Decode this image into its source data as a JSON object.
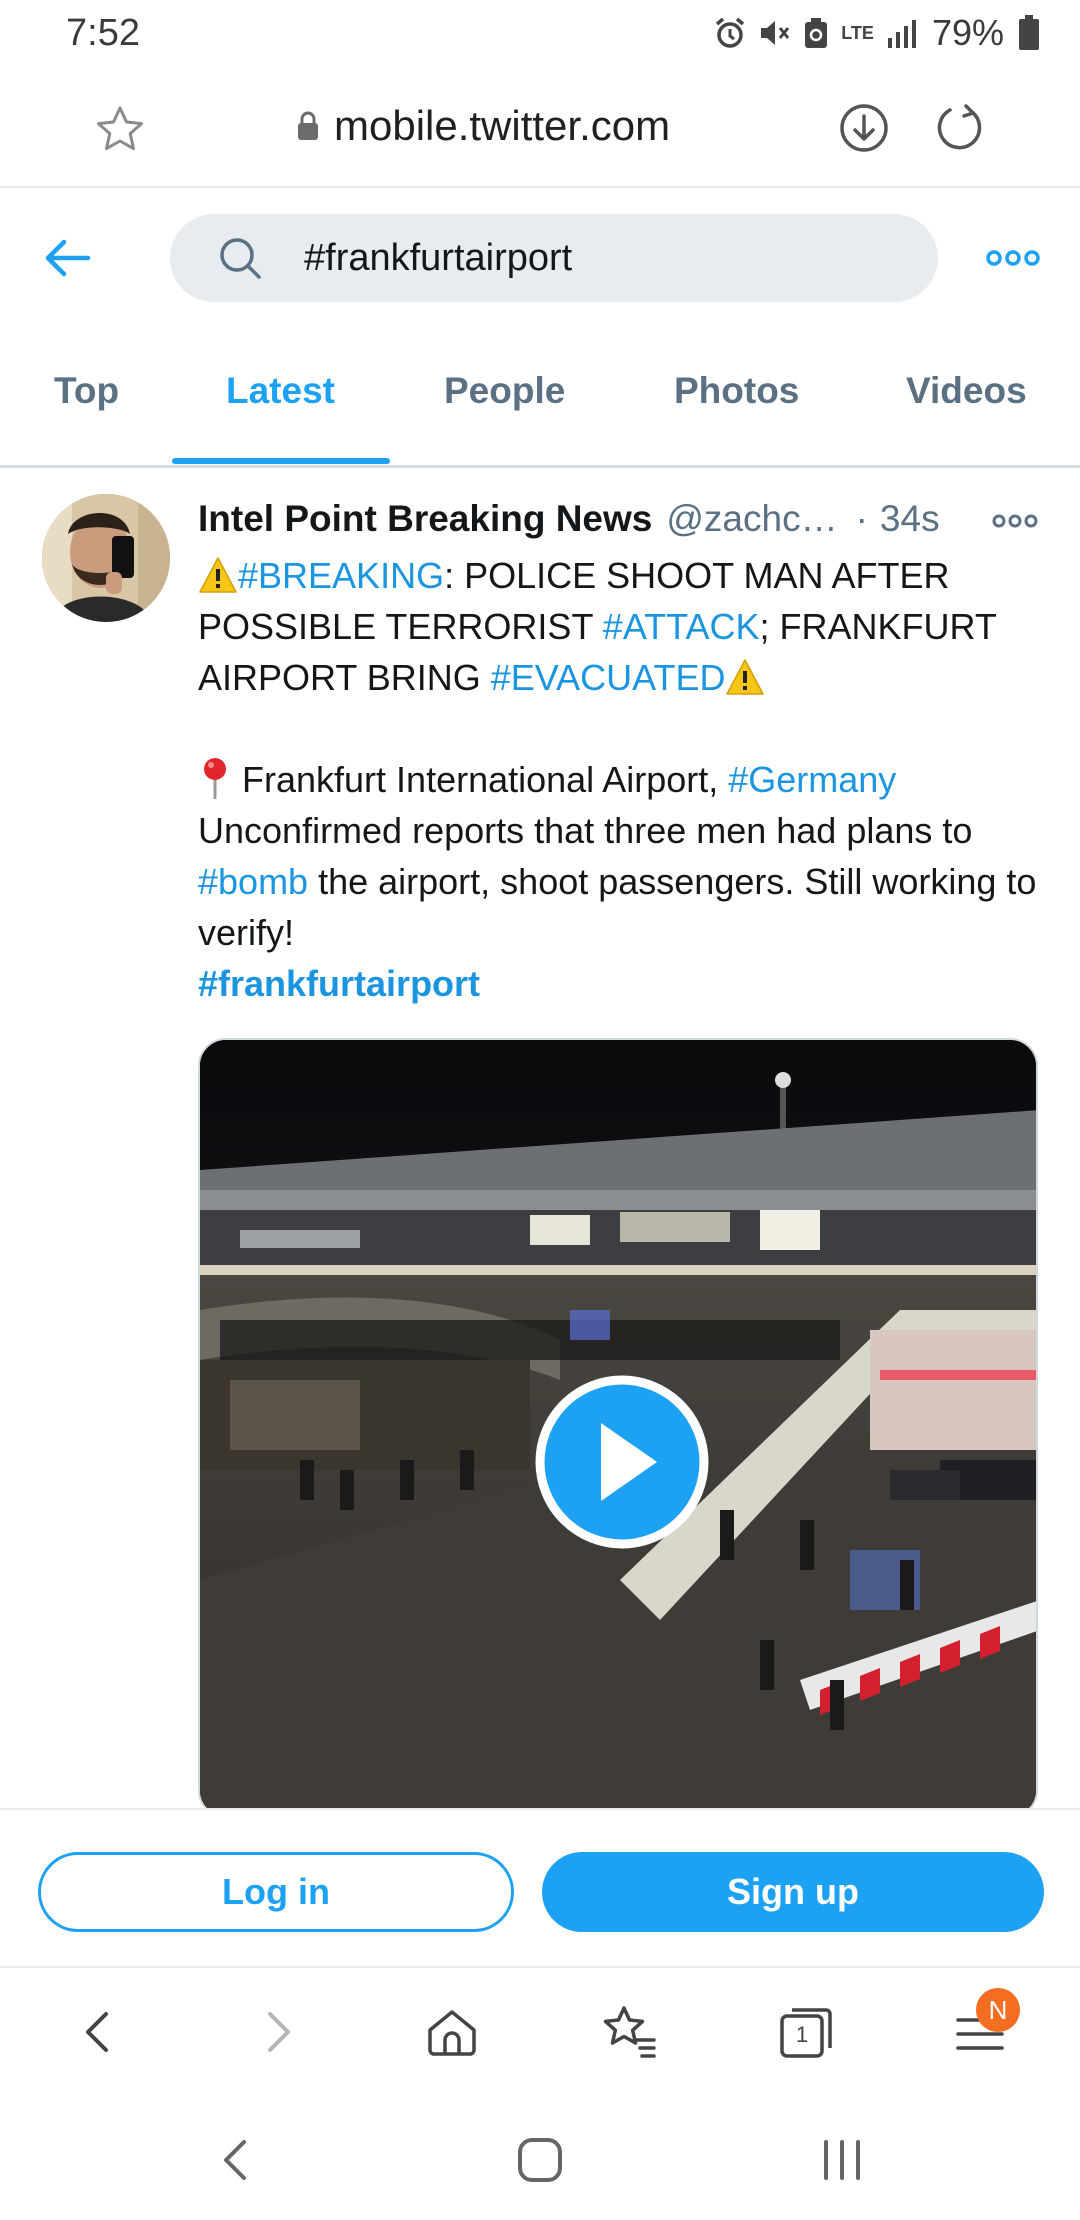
{
  "status_bar": {
    "time": "7:52",
    "network_label": "LTE",
    "battery": "79%"
  },
  "browser": {
    "url": "mobile.twitter.com"
  },
  "search": {
    "query": "#frankfurtairport"
  },
  "tabs": [
    {
      "label": "Top",
      "active": false
    },
    {
      "label": "Latest",
      "active": true
    },
    {
      "label": "People",
      "active": false
    },
    {
      "label": "Photos",
      "active": false
    },
    {
      "label": "Videos",
      "active": false
    }
  ],
  "tweet": {
    "author_name": "Intel Point Breaking News",
    "author_handle": "@zachc…",
    "separator": "·",
    "time": "34s",
    "line1_tag_breaking": "#BREAKING",
    "line1_text_a": ": POLICE SHOOT MAN AFTER POSSIBLE TERRORIST ",
    "line1_tag_attack": "#ATTACK",
    "line1_text_b": "; FRANKFURT AIRPORT BRING ",
    "line1_tag_evacuated": "#EVACUATED",
    "line2_text_a": " Frankfurt International Airport, ",
    "line2_tag_germany": "#Germany",
    "line3_text_a": "Unconfirmed reports that three men had plans to ",
    "line3_tag_bomb": "#bomb",
    "line3_text_b": " the airport, shoot passengers. Still working to verify!",
    "hashtag_link": "#frankfurtairport",
    "media_type": "video"
  },
  "auth": {
    "login_label": "Log in",
    "signup_label": "Sign up"
  },
  "bottom_toolbar": {
    "tab_count": "1",
    "menu_badge": "N"
  },
  "colors": {
    "twitter_blue": "#1da1f2",
    "link_blue": "#1b95e0",
    "secondary_text": "#5b7083",
    "badge_orange": "#f36e21"
  }
}
